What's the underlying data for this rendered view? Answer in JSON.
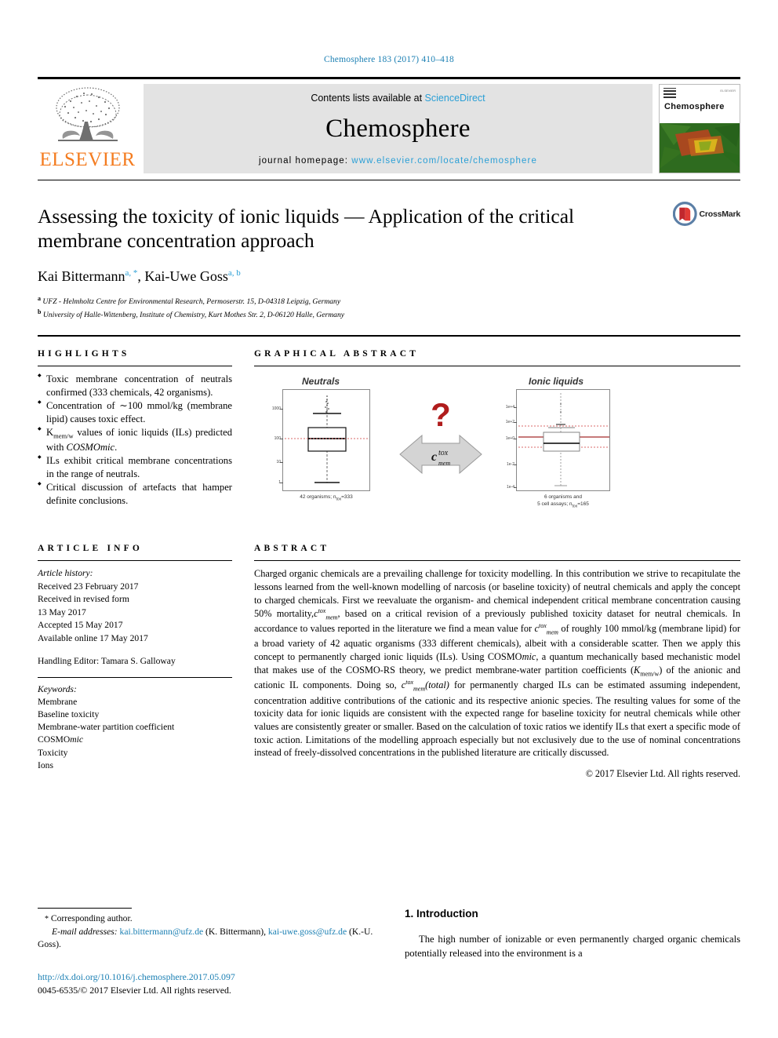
{
  "running_head": "Chemosphere 183 (2017) 410–418",
  "masthead": {
    "publisher_name": "ELSEVIER",
    "contents_prefix": "Contents lists available at",
    "contents_link": "ScienceDirect",
    "journal_name": "Chemosphere",
    "homepage_label": "journal homepage:",
    "homepage_url": "www.elsevier.com/locate/chemosphere",
    "cover_title": "Chemosphere",
    "cover_publisher": "ELSEVIER"
  },
  "article": {
    "title": "Assessing the toxicity of ionic liquids — Application of the critical membrane concentration approach",
    "authors": "Kai Bittermann, Kai-Uwe Goss",
    "author1": "Kai Bittermann",
    "author1_sup": "a, *",
    "author2": "Kai-Uwe Goss",
    "author2_sup": "a, b",
    "affiliation_a": "UFZ - Helmholtz Centre for Environmental Research, Permoserstr. 15, D-04318 Leipzig, Germany",
    "affiliation_b": "University of Halle-Wittenberg, Institute of Chemistry, Kurt Mothes Str. 2, D-06120 Halle, Germany",
    "crossmark_label": "CrossMark"
  },
  "highlights": {
    "heading": "HIGHLIGHTS",
    "items": [
      "Toxic membrane concentration of neutrals confirmed (333 chemicals, 42 organisms).",
      "Concentration of ~100 mmol/kg (membrane lipid) causes toxic effect.",
      "Kmem/w values of ionic liquids (ILs) predicted with COSMOmic.",
      "ILs exhibit critical membrane concentrations in the range of neutrals.",
      "Critical discussion of artefacts that hamper definite conclusions."
    ]
  },
  "graphical_abstract": {
    "heading": "GRAPHICAL ABSTRACT",
    "left_panel_title": "Neutrals",
    "right_panel_title": "Ionic liquids",
    "left_caption": "42 organisms; ntox=333",
    "right_caption_line1": "6 organisms and",
    "right_caption_line2": "5 cell assays; ntox=165",
    "center_symbol": "?",
    "center_label_main": "c",
    "center_label_sup": "tox",
    "center_label_sub": "mem",
    "left_axis_ticks": [
      "1000",
      "100",
      "10",
      "1"
    ],
    "right_axis_ticks": [
      "1e+4",
      "1e+2",
      "1e+0",
      "1e-2",
      "1e-4"
    ]
  },
  "article_info": {
    "heading": "ARTICLE INFO",
    "history_label": "Article history:",
    "history": [
      "Received 23 February 2017",
      "Received in revised form",
      "13 May 2017",
      "Accepted 15 May 2017",
      "Available online 17 May 2017"
    ],
    "handling_editor": "Handling Editor: Tamara S. Galloway",
    "keywords_label": "Keywords:",
    "keywords": [
      "Membrane",
      "Baseline toxicity",
      "Membrane-water partition coefficient",
      "COSMOmic",
      "Toxicity",
      "Ions"
    ]
  },
  "abstract": {
    "heading": "ABSTRACT",
    "paragraph_part1": "Charged organic chemicals are a prevailing challenge for toxicity modelling. In this contribution we strive to recapitulate the lessons learned from the well-known modelling of narcosis (or baseline toxicity) of neutral chemicals and apply the concept to charged chemicals. First we reevaluate the organism- and chemical independent critical membrane concentration causing 50% mortality,",
    "symbol1": "ctoxmem",
    "paragraph_part2": ", based on a critical revision of a previously published toxicity dataset for neutral chemicals. In accordance to values reported in the literature we find a mean value for",
    "symbol2": "ctoxmem",
    "paragraph_part3": "of roughly 100 mmol/kg (membrane lipid) for a broad variety of 42 aquatic organisms (333 different chemicals), albeit with a considerable scatter. Then we apply this concept to permanently charged ionic liquids (ILs). Using COSMOmic, a quantum mechanically based mechanistic model that makes use of the COSMO-RS theory, we predict membrane-water partition coefficients (Kmem/w) of the anionic and cationic IL components. Doing so,",
    "symbol3": "ctoxmem(total)",
    "paragraph_part4": "for permanently charged ILs can be estimated assuming independent, concentration additive contributions of the cationic and its respective anionic species. The resulting values for some of the toxicity data for ionic liquids are consistent with the expected range for baseline toxicity for neutral chemicals while other values are consistently greater or smaller. Based on the calculation of toxic ratios we identify ILs that exert a specific mode of toxic action. Limitations of the modelling approach especially but not exclusively due to the use of nominal concentrations instead of freely-dissolved concentrations in the published literature are critically discussed.",
    "copyright": "© 2017 Elsevier Ltd. All rights reserved."
  },
  "footer": {
    "corresponding_author": "Corresponding author.",
    "email_label": "E-mail addresses:",
    "email1": "kai.bittermann@ufz.de",
    "email1_name": "(K. Bittermann),",
    "email2": "kai-uwe.goss@ufz.de",
    "email2_name": "(K.-U. Goss).",
    "doi": "http://dx.doi.org/10.1016/j.chemosphere.2017.05.097",
    "issn_line": "0045-6535/© 2017 Elsevier Ltd. All rights reserved."
  },
  "introduction": {
    "heading": "1. Introduction",
    "paragraph": "The high number of ionizable or even permanently charged organic chemicals potentially released into the environment is a"
  },
  "colors": {
    "link_blue": "#1a7fb3",
    "sciencedirect_blue": "#2a9fd6",
    "elsevier_orange": "#f47c20",
    "band_gray": "#e3e3e3",
    "plot_red": "#b03030"
  }
}
